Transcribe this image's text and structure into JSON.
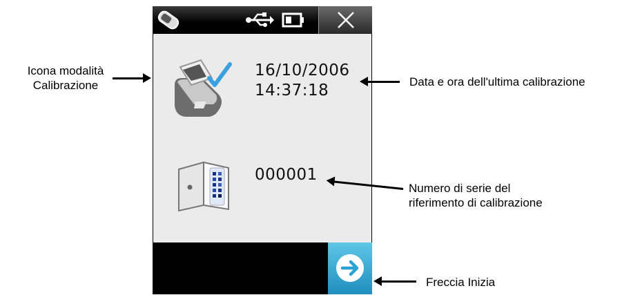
{
  "screen": {
    "calibration": {
      "date": "16/10/2006",
      "time": "14:37:18"
    },
    "reference": {
      "serial_number": "000001"
    }
  },
  "callouts": {
    "mode_icon": [
      "Icona modalità",
      "Calibrazione"
    ],
    "last_calibration": "Data e ora dell'ultima calibrazione",
    "serial": [
      "Numero di serie del",
      "riferimento di calibrazione"
    ],
    "start_arrow": "Freccia Inizia"
  },
  "icons": {
    "topbar": [
      "device-icon",
      "usb-icon",
      "battery-icon",
      "close-icon"
    ],
    "calibration_mode": "calibration-mode-icon",
    "reference": "calibration-reference-icon",
    "next": "arrow-right-icon"
  },
  "colors": {
    "screen_bg": "#ebebeb",
    "accent_blue": "#2aa3d4",
    "check_blue": "#3aa0e0"
  }
}
